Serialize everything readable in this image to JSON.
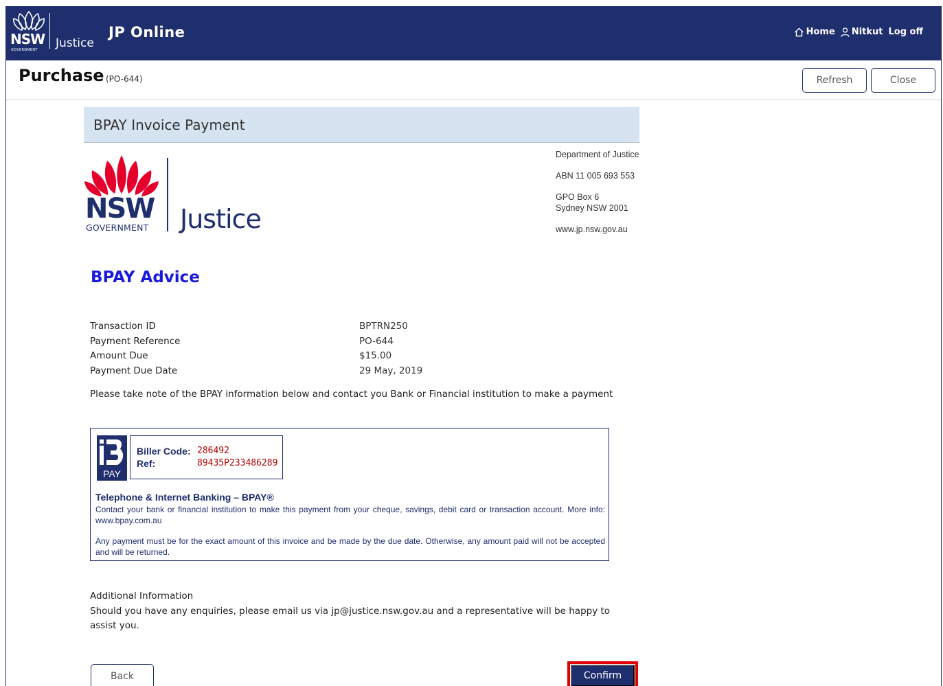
{
  "topbar": {
    "logo_nsw": "NSW",
    "logo_gov": "GOVERNMENT",
    "logo_justice": "Justice",
    "app_title": "JP Online",
    "nav": {
      "home": "Home",
      "user": "Nitkut",
      "logoff": "Log off"
    },
    "icons": [
      "home-icon",
      "user-icon"
    ]
  },
  "header": {
    "title": "Purchase",
    "subtitle": "(PO-644)",
    "refresh_label": "Refresh",
    "close_label": "Close"
  },
  "panel": {
    "title": "BPAY Invoice Payment"
  },
  "letterhead": {
    "nsw": "NSW",
    "gov": "GOVERNMENT",
    "justice": "Justice",
    "dept": "Department of Justice",
    "abn": "ABN 11 005 693 553",
    "address1": "GPO Box 6",
    "address2": "Sydney NSW 2001",
    "website": "www.jp.nsw.gov.au"
  },
  "advice": {
    "title": "BPAY Advice",
    "rows": [
      {
        "label": "Transaction ID",
        "value": "BPTRN250"
      },
      {
        "label": "Payment Reference",
        "value": "PO-644"
      },
      {
        "label": "Amount Due",
        "value": "$15.00"
      },
      {
        "label": "Payment Due Date",
        "value": "29 May, 2019"
      }
    ],
    "note": "Please take note of the BPAY information below and contact you Bank or Financial institution to make a payment"
  },
  "bpay": {
    "logo_pay": "PAY",
    "biller_label": "Biller Code:",
    "biller_code": "286492",
    "ref_label": "Ref:",
    "ref_value": "89435P233486289",
    "heading": "Telephone & Internet Banking – BPAY®",
    "text1": "Contact your bank or financial institution to make this payment from your cheque, savings, debit card or transaction account. More info: www.bpay.com.au",
    "text2": "Any payment must be for the exact amount of this invoice and be made by the due date. Otherwise, any amount paid will not be accepted and will be returned."
  },
  "additional": {
    "heading": "Additional Information",
    "text": "Should you have any enquiries, please email us via jp@justice.nsw.gov.au and a representative will be happy to assist you."
  },
  "actions": {
    "back_label": "Back",
    "confirm_label": "Confirm"
  },
  "colors": {
    "navy": "#1f2f6e",
    "panel": "#d6e3f0",
    "advice_blue": "#1a1adb",
    "highlight_red": "#e00000",
    "waratah_red": "#e4002b"
  }
}
